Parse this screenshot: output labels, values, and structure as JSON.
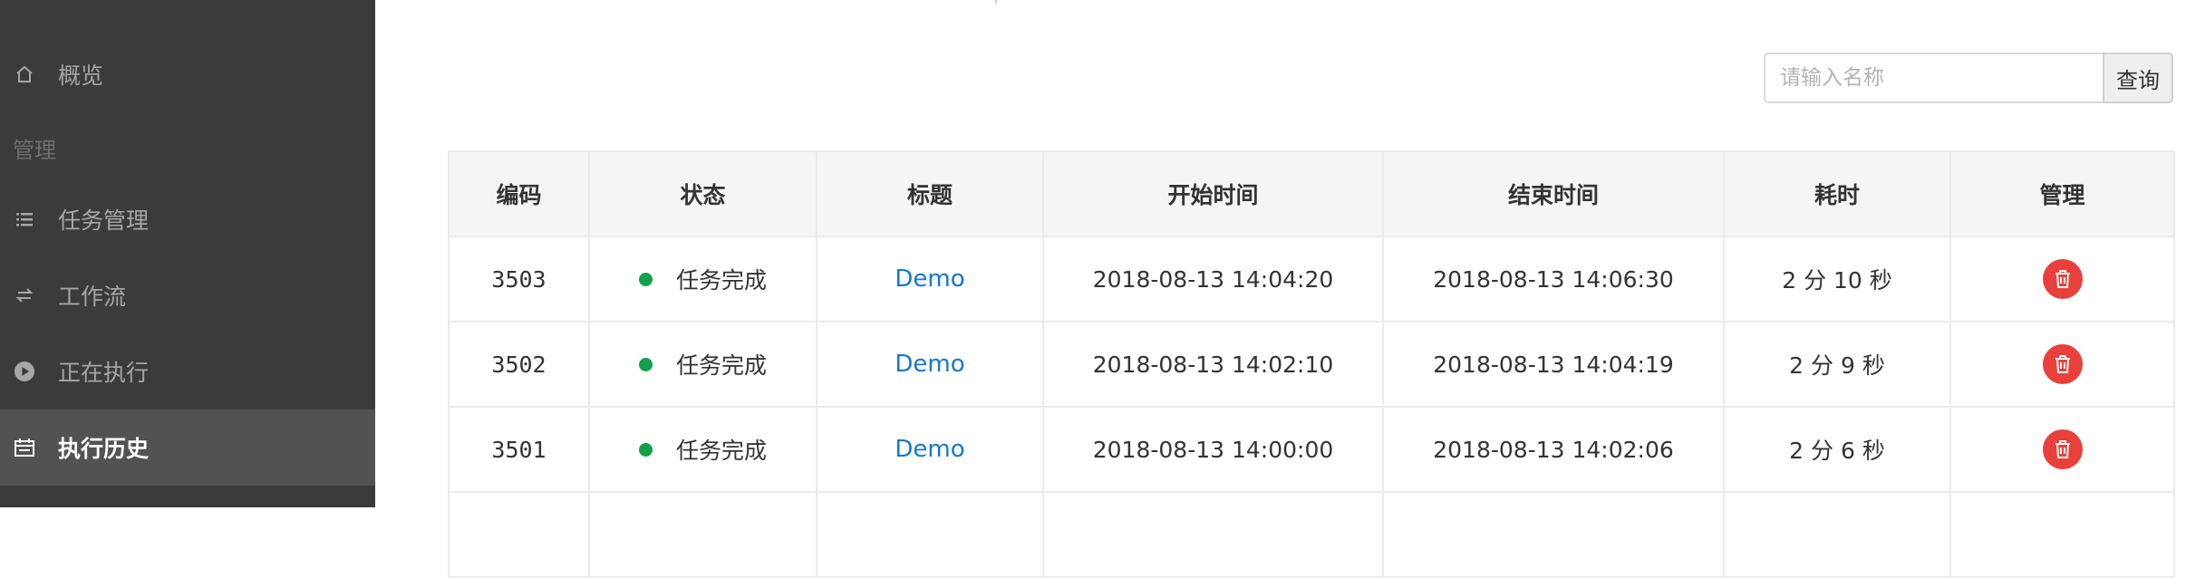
{
  "sidebar": {
    "overview_label": "概览",
    "group_label": "管理",
    "items": [
      {
        "label": "任务管理",
        "icon": "list-icon"
      },
      {
        "label": "工作流",
        "icon": "swap-icon"
      },
      {
        "label": "正在执行",
        "icon": "play-circle-icon"
      },
      {
        "label": "执行历史",
        "icon": "calendar-icon",
        "active": true
      }
    ]
  },
  "search": {
    "placeholder": "请输入名称",
    "value": "",
    "button_label": "查询"
  },
  "table": {
    "headers": [
      "编码",
      "状态",
      "标题",
      "开始时间",
      "结束时间",
      "耗时",
      "管理"
    ],
    "rows": [
      {
        "code": "3503",
        "status": "任务完成",
        "title": "Demo",
        "start": "2018-08-13 14:04:20",
        "end": "2018-08-13 14:06:30",
        "duration": "2 分 10 秒"
      },
      {
        "code": "3502",
        "status": "任务完成",
        "title": "Demo",
        "start": "2018-08-13 14:02:10",
        "end": "2018-08-13 14:04:19",
        "duration": "2 分 9 秒"
      },
      {
        "code": "3501",
        "status": "任务完成",
        "title": "Demo",
        "start": "2018-08-13 14:00:00",
        "end": "2018-08-13 14:02:06",
        "duration": "2 分 6 秒"
      }
    ]
  },
  "colors": {
    "sidebar_bg": "#3b3b3b",
    "sidebar_active_bg": "#525252",
    "status_success": "#13a04b",
    "link": "#1677d2",
    "delete_button": "#e9403b"
  }
}
